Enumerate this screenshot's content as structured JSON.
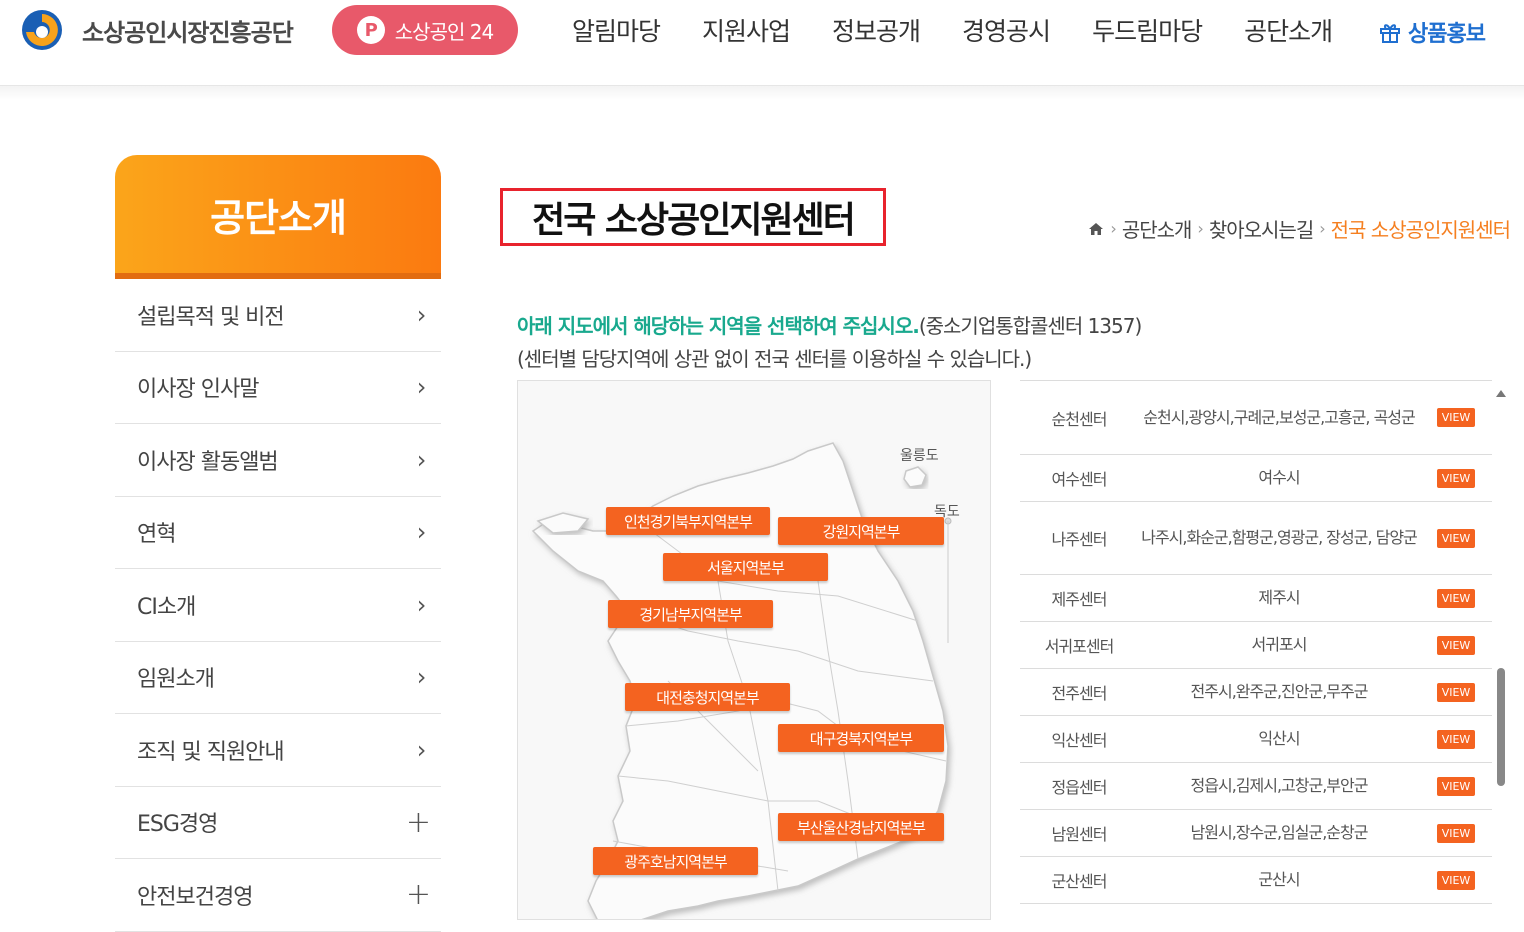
{
  "header": {
    "org_name": "소상공인시장진흥공단",
    "portal_button": "소상공인 24",
    "nav": [
      "알림마당",
      "지원사업",
      "정보공개",
      "경영공시",
      "두드림마당",
      "공단소개"
    ],
    "promo": "상품홍보"
  },
  "sidebar": {
    "title": "공단소개",
    "items": [
      {
        "label": "설립목적 및 비전",
        "icon": "chevron-right-icon"
      },
      {
        "label": "이사장 인사말",
        "icon": "chevron-right-icon"
      },
      {
        "label": "이사장 활동앨범",
        "icon": "chevron-right-icon"
      },
      {
        "label": "연혁",
        "icon": "chevron-right-icon"
      },
      {
        "label": "CI소개",
        "icon": "chevron-right-icon"
      },
      {
        "label": "임원소개",
        "icon": "chevron-right-icon"
      },
      {
        "label": "조직 및 직원안내",
        "icon": "chevron-right-icon"
      },
      {
        "label": "ESG경영",
        "icon": "plus-icon"
      },
      {
        "label": "안전보건경영",
        "icon": "plus-icon"
      }
    ]
  },
  "page": {
    "title": "전국 소상공인지원센터",
    "breadcrumb": [
      "공단소개",
      "찾아오시는길",
      "전국 소상공인지원센터"
    ],
    "guide_highlight": "아래 지도에서 해당하는 지역을 선택하여 주십시오.",
    "guide_rest": "(중소기업통합콜센터 1357)",
    "guide_line2": "(센터별 담당지역에 상관 없이 전국 센터를 이용하실 수 있습니다.)"
  },
  "map": {
    "regions": [
      "인천경기북부지역본부",
      "강원지역본부",
      "서울지역본부",
      "경기남부지역본부",
      "대전충청지역본부",
      "대구경북지역본부",
      "부산울산경남지역본부",
      "광주호남지역본부"
    ],
    "islands": [
      "울릉도",
      "독도"
    ]
  },
  "centers": {
    "view_label": "VIEW",
    "rows": [
      {
        "name": "순천센터",
        "area": "순천시,광양시,구례군,보성군,고흥군, 곡성군"
      },
      {
        "name": "여수센터",
        "area": "여수시"
      },
      {
        "name": "나주센터",
        "area": "나주시,화순군,함평군,영광군, 장성군, 담양군"
      },
      {
        "name": "제주센터",
        "area": "제주시"
      },
      {
        "name": "서귀포센터",
        "area": "서귀포시"
      },
      {
        "name": "전주센터",
        "area": "전주시,완주군,진안군,무주군"
      },
      {
        "name": "익산센터",
        "area": "익산시"
      },
      {
        "name": "정읍센터",
        "area": "정읍시,김제시,고창군,부안군"
      },
      {
        "name": "남원센터",
        "area": "남원시,장수군,임실군,순창군"
      },
      {
        "name": "군산센터",
        "area": "군산시"
      }
    ]
  }
}
